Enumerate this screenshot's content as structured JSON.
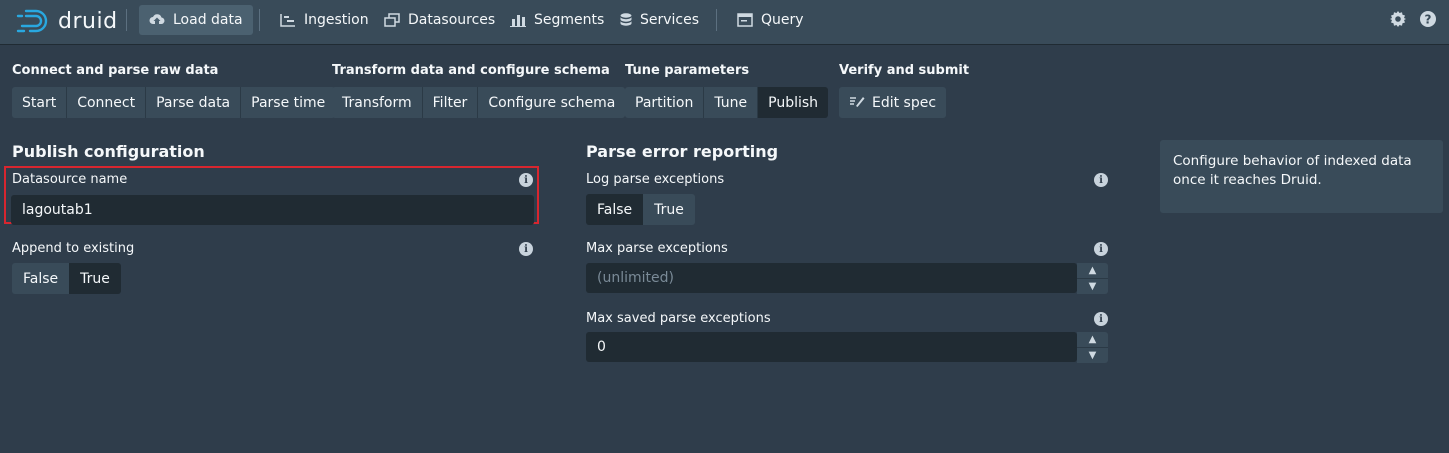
{
  "app": {
    "logo_text": "druid"
  },
  "nav": {
    "load_data": "Load data",
    "ingestion": "Ingestion",
    "datasources": "Datasources",
    "segments": "Segments",
    "services": "Services",
    "query": "Query"
  },
  "steps": {
    "group1": {
      "title": "Connect and parse raw data",
      "items": [
        "Start",
        "Connect",
        "Parse data",
        "Parse time"
      ]
    },
    "group2": {
      "title": "Transform data and configure schema",
      "items": [
        "Transform",
        "Filter",
        "Configure schema"
      ]
    },
    "group3": {
      "title": "Tune parameters",
      "items": [
        "Partition",
        "Tune",
        "Publish"
      ],
      "active": "Publish"
    },
    "group4": {
      "title": "Verify and submit",
      "items": [
        "Edit spec"
      ]
    }
  },
  "publish": {
    "title": "Publish configuration",
    "datasource_label": "Datasource name",
    "datasource_value": "lagoutab1",
    "append_label": "Append to existing",
    "append_options": [
      "False",
      "True"
    ],
    "append_selected": "False"
  },
  "parse_errors": {
    "title": "Parse error reporting",
    "log_label": "Log parse exceptions",
    "log_options": [
      "False",
      "True"
    ],
    "log_selected": "True",
    "max_label": "Max parse exceptions",
    "max_placeholder": "(unlimited)",
    "saved_label": "Max saved parse exceptions",
    "saved_value": "0"
  },
  "callout": {
    "text": "Configure behavior of indexed data once it reaches Druid."
  },
  "icons": {
    "info": "i",
    "up": "▲",
    "down": "▼"
  }
}
